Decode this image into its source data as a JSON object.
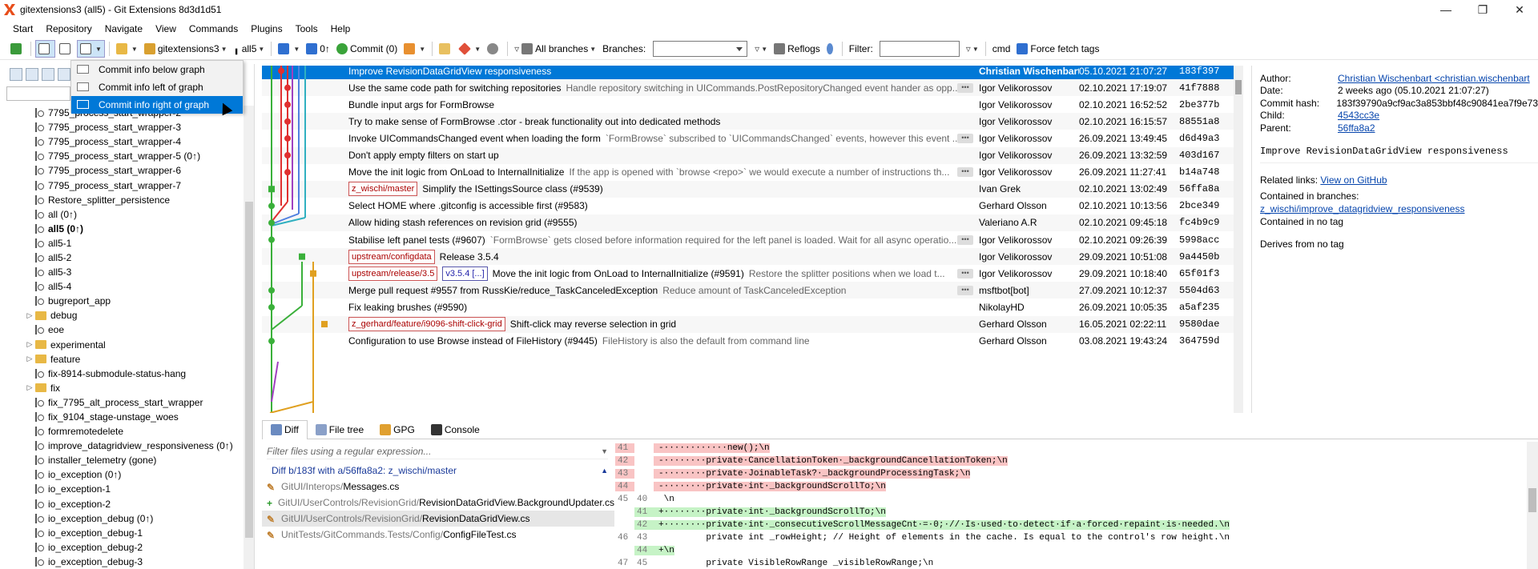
{
  "window": {
    "title": "gitextensions3 (all5) - Git Extensions 8d3d1d51"
  },
  "menu": [
    "Start",
    "Repository",
    "Navigate",
    "View",
    "Commands",
    "Plugins",
    "Tools",
    "Help"
  ],
  "toolbar": {
    "repo": "gitextensions3",
    "branch": "all5",
    "counts": "0↑",
    "commit": "Commit (0)",
    "all_branches": "All branches",
    "branches_label": "Branches:",
    "reflogs": "Reflogs",
    "filter_label": "Filter:",
    "cmd": "cmd",
    "force_fetch": "Force fetch tags"
  },
  "layout_menu": [
    {
      "label": "Commit info below graph",
      "selected": false
    },
    {
      "label": "Commit info left of graph",
      "selected": false
    },
    {
      "label": "Commit info right of graph",
      "selected": true
    }
  ],
  "branches": [
    {
      "label": "7795_process_start_wrapper-2",
      "folder": false,
      "bold": false,
      "expandable": false
    },
    {
      "label": "7795_process_start_wrapper-3",
      "folder": false,
      "bold": false,
      "expandable": false
    },
    {
      "label": "7795_process_start_wrapper-4",
      "folder": false,
      "bold": false,
      "expandable": false
    },
    {
      "label": "7795_process_start_wrapper-5 (0↑)",
      "folder": false,
      "bold": false,
      "expandable": false
    },
    {
      "label": "7795_process_start_wrapper-6",
      "folder": false,
      "bold": false,
      "expandable": false
    },
    {
      "label": "7795_process_start_wrapper-7",
      "folder": false,
      "bold": false,
      "expandable": false
    },
    {
      "label": "Restore_splitter_persistence",
      "folder": false,
      "bold": false,
      "expandable": false
    },
    {
      "label": "all (0↑)",
      "folder": false,
      "bold": false,
      "expandable": false
    },
    {
      "label": "all5 (0↑)",
      "folder": false,
      "bold": true,
      "expandable": false
    },
    {
      "label": "all5-1",
      "folder": false,
      "bold": false,
      "expandable": false
    },
    {
      "label": "all5-2",
      "folder": false,
      "bold": false,
      "expandable": false
    },
    {
      "label": "all5-3",
      "folder": false,
      "bold": false,
      "expandable": false
    },
    {
      "label": "all5-4",
      "folder": false,
      "bold": false,
      "expandable": false
    },
    {
      "label": "bugreport_app",
      "folder": false,
      "bold": false,
      "expandable": false
    },
    {
      "label": "debug",
      "folder": true,
      "bold": false,
      "expandable": true
    },
    {
      "label": "eoe",
      "folder": false,
      "bold": false,
      "expandable": false
    },
    {
      "label": "experimental",
      "folder": true,
      "bold": false,
      "expandable": true
    },
    {
      "label": "feature",
      "folder": true,
      "bold": false,
      "expandable": true
    },
    {
      "label": "fix-8914-submodule-status-hang",
      "folder": false,
      "bold": false,
      "expandable": false
    },
    {
      "label": "fix",
      "folder": true,
      "bold": false,
      "expandable": true
    },
    {
      "label": "fix_7795_alt_process_start_wrapper",
      "folder": false,
      "bold": false,
      "expandable": false
    },
    {
      "label": "fix_9104_stage-unstage_woes",
      "folder": false,
      "bold": false,
      "expandable": false
    },
    {
      "label": "formremotedelete",
      "folder": false,
      "bold": false,
      "expandable": false
    },
    {
      "label": "improve_datagridview_responsiveness (0↑)",
      "folder": false,
      "bold": false,
      "expandable": false
    },
    {
      "label": "installer_telemetry (gone)",
      "folder": false,
      "bold": false,
      "expandable": false
    },
    {
      "label": "io_exception (0↑)",
      "folder": false,
      "bold": false,
      "expandable": false
    },
    {
      "label": "io_exception-1",
      "folder": false,
      "bold": false,
      "expandable": false
    },
    {
      "label": "io_exception-2",
      "folder": false,
      "bold": false,
      "expandable": false
    },
    {
      "label": "io_exception_debug (0↑)",
      "folder": false,
      "bold": false,
      "expandable": false
    },
    {
      "label": "io_exception_debug-1",
      "folder": false,
      "bold": false,
      "expandable": false
    },
    {
      "label": "io_exception_debug-2",
      "folder": false,
      "bold": false,
      "expandable": false
    },
    {
      "label": "io_exception_debug-3",
      "folder": false,
      "bold": false,
      "expandable": false
    }
  ],
  "commits": [
    {
      "refs": [],
      "subject": "Improve RevisionDataGridView responsiveness",
      "body": "",
      "author": "Christian Wischenbart",
      "date": "05.10.2021 21:07:27",
      "hash": "183f397",
      "more": false,
      "selected": true
    },
    {
      "refs": [],
      "subject": "Use the same code path for switching repositories",
      "body": "Handle repository switching in UICommands.PostRepositoryChanged event hander as opp...",
      "author": "Igor Velikorossov",
      "date": "02.10.2021 17:19:07",
      "hash": "41f7888",
      "more": true,
      "selected": false
    },
    {
      "refs": [],
      "subject": "Bundle input args for FormBrowse",
      "body": "",
      "author": "Igor Velikorossov",
      "date": "02.10.2021 16:52:52",
      "hash": "2be377b",
      "more": false,
      "selected": false
    },
    {
      "refs": [],
      "subject": "Try to make sense of FormBrowse .ctor - break functionality out into dedicated methods",
      "body": "",
      "author": "Igor Velikorossov",
      "date": "02.10.2021 16:15:57",
      "hash": "88551a8",
      "more": false,
      "selected": false
    },
    {
      "refs": [],
      "subject": "Invoke UICommandsChanged event when loading the form",
      "body": "`FormBrowse` subscribed to `UICommandsChanged` events, however this event ...",
      "author": "Igor Velikorossov",
      "date": "26.09.2021 13:49:45",
      "hash": "d6d49a3",
      "more": true,
      "selected": false
    },
    {
      "refs": [],
      "subject": "Don't apply empty filters on start up",
      "body": "",
      "author": "Igor Velikorossov",
      "date": "26.09.2021 13:32:59",
      "hash": "403d167",
      "more": false,
      "selected": false
    },
    {
      "refs": [],
      "subject": "Move the init logic from OnLoad to InternalInitialize",
      "body": "If the app is opened with `browse <repo>` we would execute a number of instructions th...",
      "author": "Igor Velikorossov",
      "date": "26.09.2021 11:27:41",
      "hash": "b14a748",
      "more": true,
      "selected": false
    },
    {
      "refs": [
        {
          "label": "z_wischi/master",
          "tag": false
        }
      ],
      "subject": "Simplify the ISettingsSource class (#9539)",
      "body": "",
      "author": "Ivan Grek",
      "date": "02.10.2021 13:02:49",
      "hash": "56ffa8a",
      "more": false,
      "selected": false
    },
    {
      "refs": [],
      "subject": "Select HOME where .gitconfig is accessible first (#9583)",
      "body": "",
      "author": "Gerhard Olsson",
      "date": "02.10.2021 10:13:56",
      "hash": "2bce349",
      "more": false,
      "selected": false
    },
    {
      "refs": [],
      "subject": "Allow hiding stash references on revision grid (#9555)",
      "body": "",
      "author": "Valeriano A.R",
      "date": "02.10.2021 09:45:18",
      "hash": "fc4b9c9",
      "more": false,
      "selected": false
    },
    {
      "refs": [],
      "subject": "Stabilise left panel tests (#9607)",
      "body": "`FormBrowse` gets closed before information required for the left panel is loaded. Wait for all async operatio...",
      "author": "Igor Velikorossov",
      "date": "02.10.2021 09:26:39",
      "hash": "5998acc",
      "more": true,
      "selected": false
    },
    {
      "refs": [
        {
          "label": "upstream/configdata",
          "tag": false
        }
      ],
      "subject": "Release 3.5.4",
      "body": "",
      "author": "Igor Velikorossov",
      "date": "29.09.2021 10:51:08",
      "hash": "9a4450b",
      "more": false,
      "selected": false
    },
    {
      "refs": [
        {
          "label": "upstream/release/3.5",
          "tag": false
        },
        {
          "label": "v3.5.4 [...]",
          "tag": true
        }
      ],
      "subject": "Move the init logic from OnLoad to InternalInitialize (#9591)",
      "body": "Restore the splitter positions when we load t...",
      "author": "Igor Velikorossov",
      "date": "29.09.2021 10:18:40",
      "hash": "65f01f3",
      "more": true,
      "selected": false
    },
    {
      "refs": [],
      "subject": "Merge pull request #9557 from RussKie/reduce_TaskCanceledException",
      "body": "Reduce amount of TaskCanceledException",
      "author": "msftbot[bot]",
      "date": "27.09.2021 10:12:37",
      "hash": "5504d63",
      "more": true,
      "selected": false
    },
    {
      "refs": [],
      "subject": "Fix leaking brushes (#9590)",
      "body": "",
      "author": "NikolayHD",
      "date": "26.09.2021 10:05:35",
      "hash": "a5af235",
      "more": false,
      "selected": false
    },
    {
      "refs": [
        {
          "label": "z_gerhard/feature/i9096-shift-click-grid",
          "tag": false
        }
      ],
      "subject": "Shift-click may reverse selection in grid",
      "body": "",
      "author": "Gerhard Olsson",
      "date": "16.05.2021 02:22:11",
      "hash": "9580dae",
      "more": false,
      "selected": false
    },
    {
      "refs": [],
      "subject": "Configuration to use Browse instead of FileHistory (#9445)",
      "body": "FileHistory is also the default from command line",
      "author": "Gerhard Olsson",
      "date": "03.08.2021 19:43:24",
      "hash": "364759d",
      "more": false,
      "selected": false
    }
  ],
  "commit_info": {
    "author_label": "Author:",
    "author": "Christian Wischenbart <christian.wischenbart",
    "date_label": "Date:",
    "date": "2 weeks ago (05.10.2021 21:07:27)",
    "hash_label": "Commit hash:",
    "hash": "183f39790a9cf9ac3a853bbf48c90841ea7f9e73",
    "child_label": "Child:",
    "child": "4543cc3e",
    "parent_label": "Parent:",
    "parent": "56ffa8a2",
    "message": "Improve RevisionDataGridView responsiveness",
    "related_label": "Related links:",
    "related": "View on GitHub",
    "branches_label": "Contained in branches:",
    "branch": "z_wischi/improve_datagridview_responsiveness",
    "tags": "Contained in no tag",
    "derives": "Derives from no tag"
  },
  "tabs": [
    "Diff",
    "File tree",
    "GPG",
    "Console"
  ],
  "files": {
    "filter_placeholder": "Filter files using a regular expression...",
    "diff_header": "Diff b/183f with a/56ffa8a2: z_wischi/master",
    "items": [
      {
        "path": "GitUI/Interops/",
        "name": "Messages.cs",
        "status": "modified",
        "selected": false
      },
      {
        "path": "GitUI/UserControls/RevisionGrid/",
        "name": "RevisionDataGridView.BackgroundUpdater.cs",
        "status": "added",
        "selected": false
      },
      {
        "path": "GitUI/UserControls/RevisionGrid/",
        "name": "RevisionDataGridView.cs",
        "status": "modified",
        "selected": true
      },
      {
        "path": "UnitTests/GitCommands.Tests/Config/",
        "name": "ConfigFileTest.cs",
        "status": "modified",
        "selected": false
      }
    ]
  },
  "diff": [
    {
      "type": "del",
      "n1": "41",
      "n2": "",
      "code": "-············new();\\n"
    },
    {
      "type": "del",
      "n1": "42",
      "n2": "",
      "code": "-········private·CancellationToken·_backgroundCancellationToken;\\n"
    },
    {
      "type": "del",
      "n1": "43",
      "n2": "",
      "code": "-········private·JoinableTask?·_backgroundProcessingTask;\\n"
    },
    {
      "type": "del",
      "n1": "44",
      "n2": "",
      "code": "-········private·int·_backgroundScrollTo;\\n"
    },
    {
      "type": "ctx",
      "n1": "45",
      "n2": "40",
      "code": " \\n"
    },
    {
      "type": "add",
      "n1": "",
      "n2": "41",
      "code": "+········private·int·_backgroundScrollTo;\\n"
    },
    {
      "type": "add",
      "n1": "",
      "n2": "42",
      "code": "+········private·int·_consecutiveScrollMessageCnt·=·0;·//·Is·used·to·detect·if·a·forced·repaint·is·needed.\\n"
    },
    {
      "type": "ctx",
      "n1": "46",
      "n2": "43",
      "code": "         private int _rowHeight; // Height of elements in the cache. Is equal to the control's row height.\\n"
    },
    {
      "type": "add",
      "n1": "",
      "n2": "44",
      "code": "+\\n"
    },
    {
      "type": "ctx",
      "n1": "47",
      "n2": "45",
      "code": "         private VisibleRowRange _visibleRowRange;\\n"
    }
  ]
}
